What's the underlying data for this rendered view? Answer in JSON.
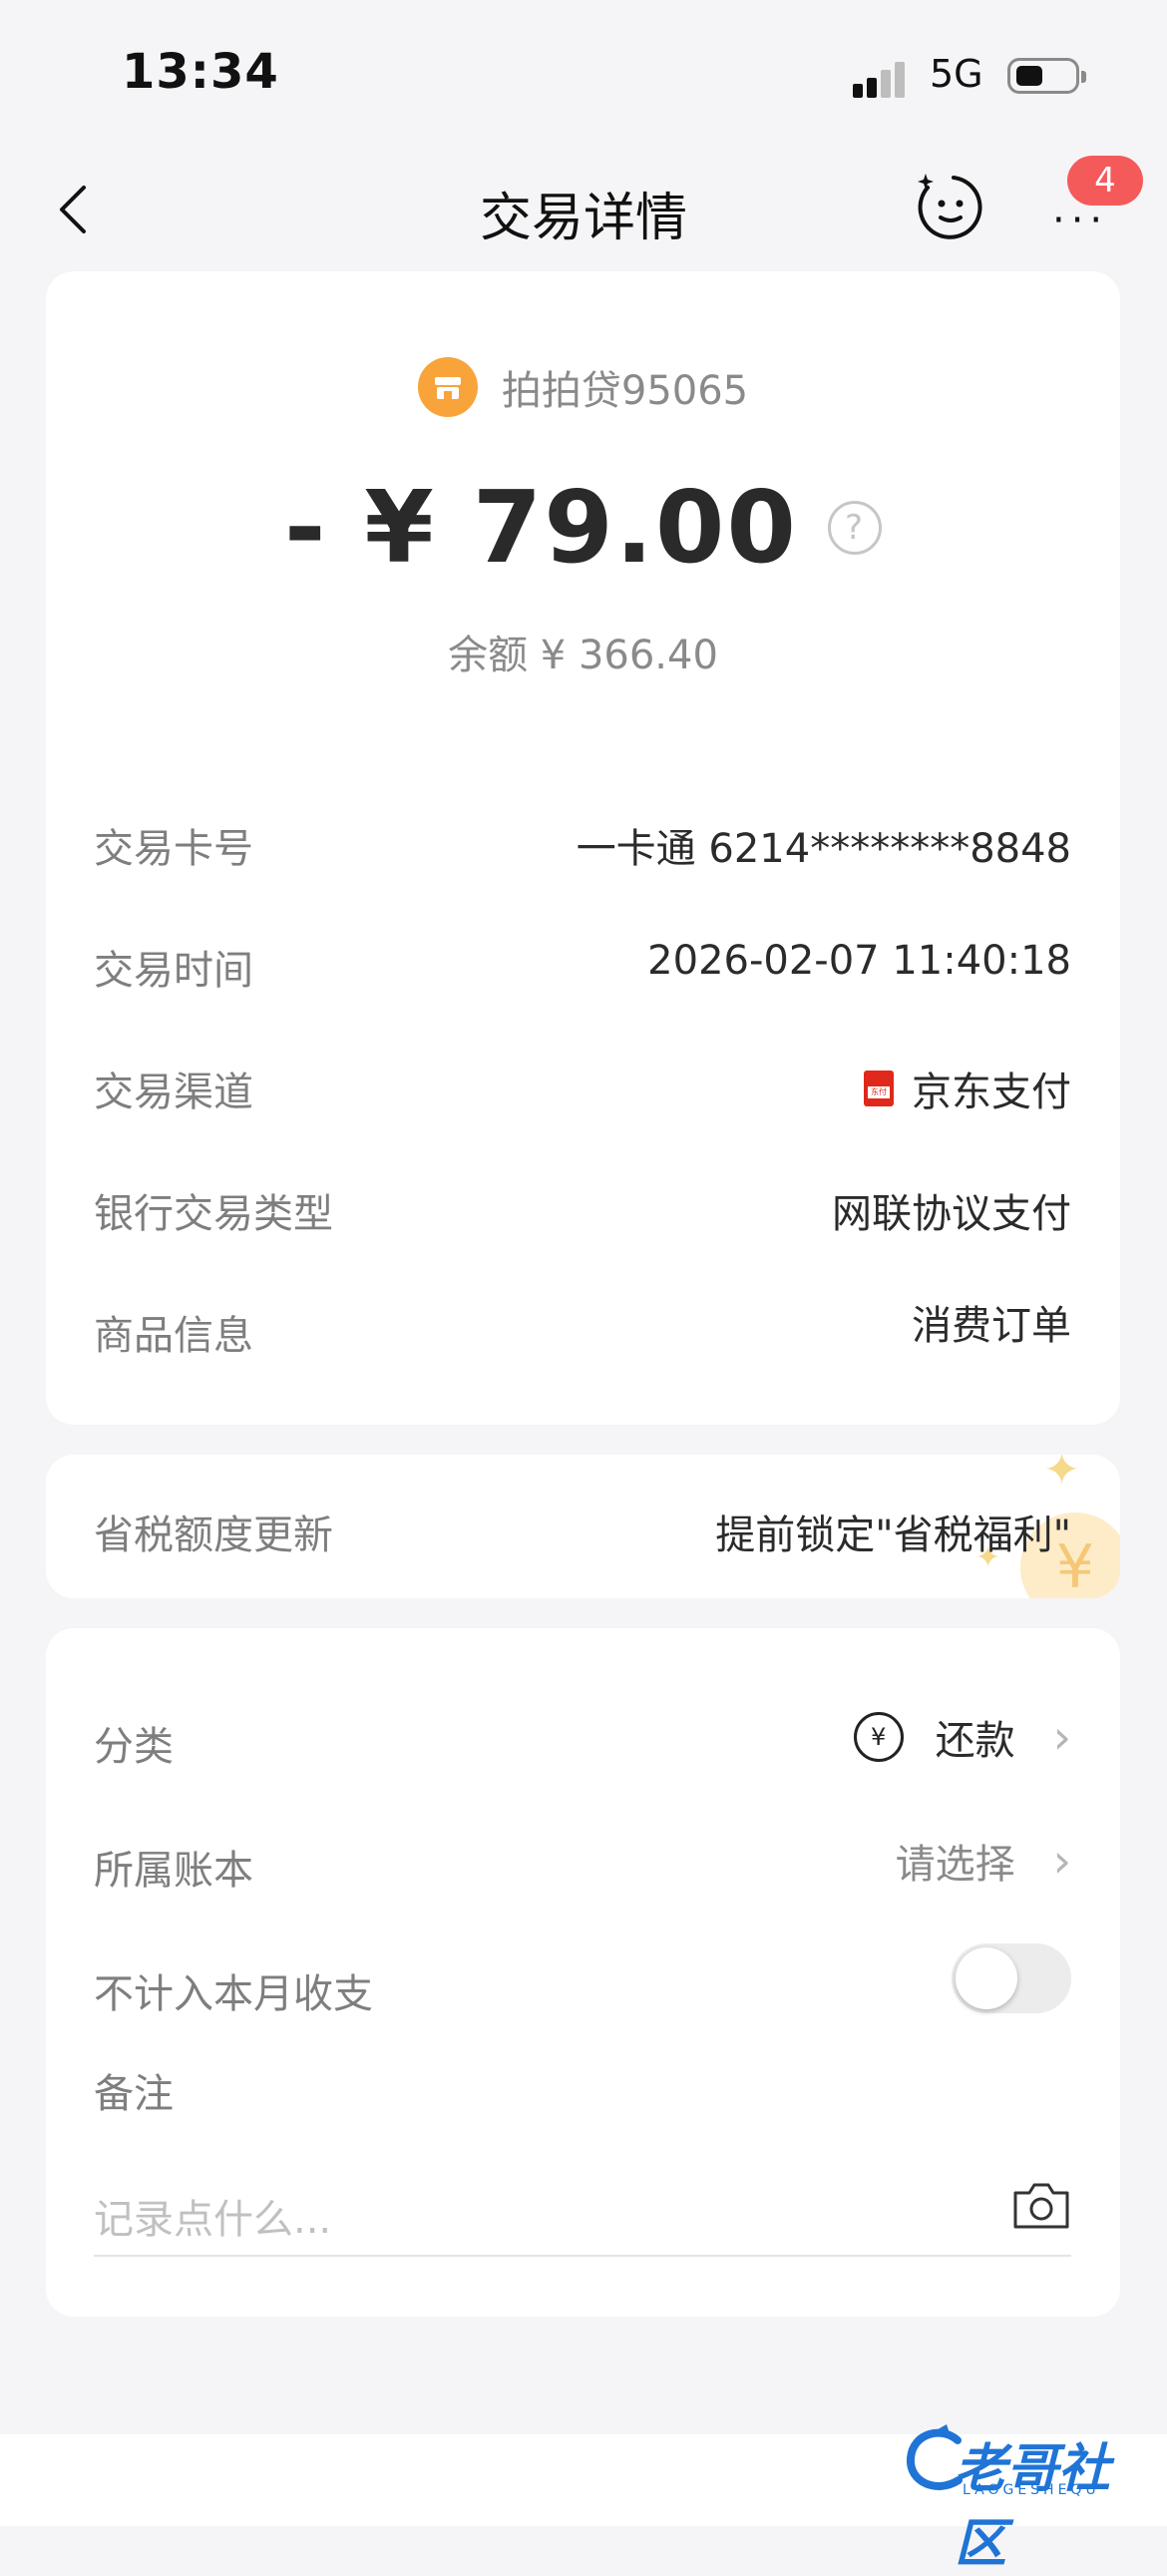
{
  "status_bar": {
    "time": "13:34",
    "network": "5G"
  },
  "nav": {
    "title": "交易详情",
    "badge_count": "4",
    "more_label": "···"
  },
  "summary": {
    "merchant": "拍拍贷95065",
    "amount": "- ¥ 79.00",
    "help_glyph": "?",
    "balance": "余额 ¥ 366.40"
  },
  "details": [
    {
      "label": "交易卡号",
      "value": "一卡通 6214********8848"
    },
    {
      "label": "交易时间",
      "value": "2026-02-07 11:40:18"
    },
    {
      "label": "交易渠道",
      "value": "京东支付",
      "icon": "jd-pay-icon",
      "icon_text": "东付"
    },
    {
      "label": "银行交易类型",
      "value": "网联协议支付"
    },
    {
      "label": "商品信息",
      "value": "消费订单"
    }
  ],
  "tax": {
    "label": "省税额度更新",
    "value": "提前锁定\"省税福利\"",
    "deco_glyph": "¥"
  },
  "settings": {
    "category": {
      "label": "分类",
      "value": "还款",
      "icon_glyph": "¥"
    },
    "book": {
      "label": "所属账本",
      "value": "请选择"
    },
    "exclude": {
      "label": "不计入本月收支",
      "enabled": false
    },
    "note": {
      "label": "备注",
      "placeholder": "记录点什么..."
    }
  },
  "chevron_glyph": "›",
  "watermark": {
    "text": "老哥社区",
    "sub": "LAOGESHEQU"
  },
  "colors": {
    "accent_orange": "#f8a43b",
    "badge_red": "#f55a5a",
    "jd_red": "#e0281b",
    "page_bg": "#f5f5f7"
  }
}
